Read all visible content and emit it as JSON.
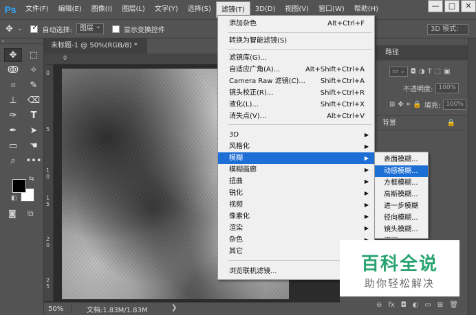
{
  "app": {
    "logo": "Ps"
  },
  "menubar": {
    "items": [
      "文件(F)",
      "编辑(E)",
      "图像(I)",
      "图层(L)",
      "文字(Y)",
      "选择(S)",
      "滤镜(T)",
      "3D(D)",
      "视图(V)",
      "窗口(W)",
      "帮助(H)"
    ],
    "active_index": 6,
    "window_controls": [
      "—",
      "□",
      "✕"
    ]
  },
  "options": {
    "auto_select_label": "自动选择:",
    "auto_select_checked": true,
    "target_value": "图层",
    "show_transform_label": "显示变换控件",
    "show_transform_checked": false,
    "mode_label": "3D 模式:"
  },
  "document": {
    "tab_title": "未标题-1 @ 50%(RGB/8) *",
    "tab_close": "×",
    "zoom": "50%",
    "doc_info": "文档:1.83M/1.83M",
    "status_arrow": "❯",
    "ruler_top_numbers": [
      "0"
    ],
    "ruler_left_numbers": [
      "0",
      "5",
      "1\n0",
      "1\n5",
      "2\n0",
      "2\n5"
    ]
  },
  "filter_menu": {
    "items": [
      {
        "label": "添加杂色",
        "shortcut": "Alt+Ctrl+F"
      },
      {
        "label": "转换为智能滤镜(S)",
        "shortcut": ""
      },
      {
        "label": "滤镜库(G)...",
        "shortcut": ""
      },
      {
        "label": "自适应广角(A)...",
        "shortcut": "Alt+Shift+Ctrl+A"
      },
      {
        "label": "Camera Raw 滤镜(C)...",
        "shortcut": "Shift+Ctrl+A"
      },
      {
        "label": "镜头校正(R)...",
        "shortcut": "Shift+Ctrl+R"
      },
      {
        "label": "液化(L)...",
        "shortcut": "Shift+Ctrl+X"
      },
      {
        "label": "消失点(V)...",
        "shortcut": "Alt+Ctrl+V"
      },
      {
        "label": "3D",
        "shortcut": ""
      },
      {
        "label": "风格化",
        "shortcut": ""
      },
      {
        "label": "模糊",
        "shortcut": ""
      },
      {
        "label": "模糊画廊",
        "shortcut": ""
      },
      {
        "label": "扭曲",
        "shortcut": ""
      },
      {
        "label": "锐化",
        "shortcut": ""
      },
      {
        "label": "视频",
        "shortcut": ""
      },
      {
        "label": "像素化",
        "shortcut": ""
      },
      {
        "label": "渲染",
        "shortcut": ""
      },
      {
        "label": "杂色",
        "shortcut": ""
      },
      {
        "label": "其它",
        "shortcut": ""
      },
      {
        "label": "浏览联机滤镜...",
        "shortcut": ""
      }
    ]
  },
  "blur_submenu": {
    "items": [
      "表面模糊...",
      "动感模糊...",
      "方框模糊...",
      "高斯模糊...",
      "进一步模糊",
      "径向模糊...",
      "镜头模糊...",
      "模糊"
    ],
    "highlight_index": 1
  },
  "panels": {
    "tab_paths": "路径",
    "opacity_label": "不透明度:",
    "opacity_value": "100%",
    "fill_label": "填充:",
    "fill_value": "100%",
    "layer_name": "背景",
    "lock_icon": "🔒",
    "footer_icons": [
      "⊖",
      "fx",
      "◘",
      "◐",
      "▭",
      "⊞",
      "🗑"
    ]
  },
  "watermark": {
    "title": "百科全说",
    "subtitle": "助你轻松解决"
  }
}
